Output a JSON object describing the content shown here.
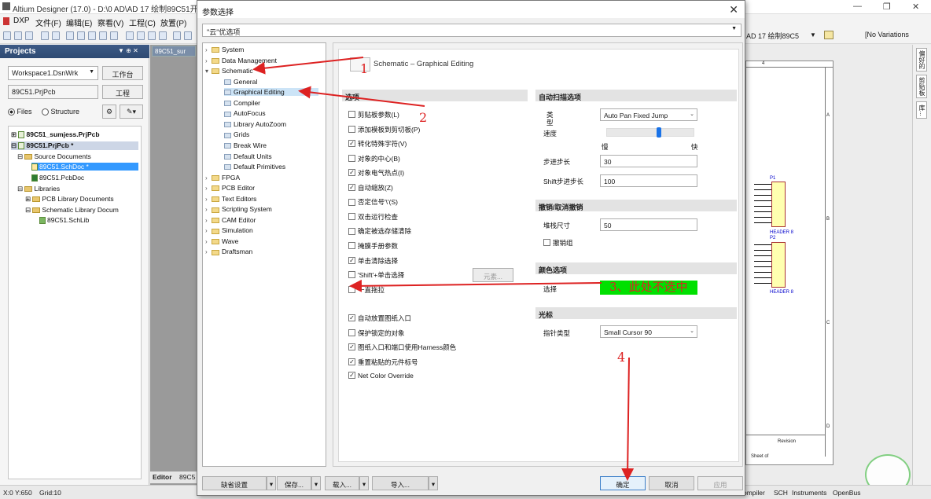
{
  "app": {
    "title": "Altium Designer (17.0) - D:\\0 AD\\AD 17 绘制89C51开",
    "menu": [
      "DXP",
      "文件(F)",
      "编辑(E)",
      "察看(V)",
      "工程(C)",
      "放置(P)"
    ],
    "toolbar_right": {
      "doc_combo": "AD 17 绘制89C5",
      "variations": "[No Variations"
    },
    "window_controls": [
      "—",
      "❐",
      "✕"
    ]
  },
  "projects": {
    "title": "Projects",
    "workspace": "Workspace1.DsnWrk",
    "workspace_btn": "工作台",
    "project_field": "89C51.PrjPcb",
    "project_btn": "工程",
    "radio_files": "Files",
    "radio_structure": "Structure",
    "tree": [
      "89C51_sumjess.PrjPcb",
      "89C51.PrjPcb *",
      "Source Documents",
      "89C51.SchDoc *",
      "89C51.PcbDoc",
      "Libraries",
      "PCB Library Documents",
      "Schematic Library Docum",
      "89C51.SchLib"
    ]
  },
  "editor": {
    "tab": "89C51_sur",
    "bottom_tab": "Editor",
    "bottom_tab2": "89C5"
  },
  "statusbar": {
    "coords": "X:0 Y:650",
    "grid": "Grid:10",
    "right_tabs": [
      "ompiler",
      "SCH",
      "Instruments",
      "OpenBus"
    ]
  },
  "rightbar": [
    "偏好的",
    "剪贴板",
    "库..."
  ],
  "schematic": {
    "col_label": "4",
    "rows": [
      "A",
      "B",
      "C",
      "D"
    ],
    "part1": "P1",
    "part2": "P2",
    "hdr": "HEADER 8",
    "revision": "Revision",
    "sheet": "Sheet of"
  },
  "dialog": {
    "title": "参数选择",
    "combo": "\"云\"优选项",
    "tree": [
      {
        "label": "System",
        "type": "folder",
        "level": 0
      },
      {
        "label": "Data Management",
        "type": "folder",
        "level": 0
      },
      {
        "label": "Schematic",
        "type": "folder",
        "level": 0,
        "expanded": true
      },
      {
        "label": "General",
        "type": "page",
        "level": 1
      },
      {
        "label": "Graphical Editing",
        "type": "page",
        "level": 1,
        "selected": true
      },
      {
        "label": "Compiler",
        "type": "page",
        "level": 1
      },
      {
        "label": "AutoFocus",
        "type": "page",
        "level": 1
      },
      {
        "label": "Library AutoZoom",
        "type": "page",
        "level": 1
      },
      {
        "label": "Grids",
        "type": "page",
        "level": 1
      },
      {
        "label": "Break Wire",
        "type": "page",
        "level": 1
      },
      {
        "label": "Default Units",
        "type": "page",
        "level": 1
      },
      {
        "label": "Default Primitives",
        "type": "page",
        "level": 1
      },
      {
        "label": "FPGA",
        "type": "folder",
        "level": 0
      },
      {
        "label": "PCB Editor",
        "type": "folder",
        "level": 0
      },
      {
        "label": "Text Editors",
        "type": "folder",
        "level": 0
      },
      {
        "label": "Scripting System",
        "type": "folder",
        "level": 0
      },
      {
        "label": "CAM Editor",
        "type": "folder",
        "level": 0
      },
      {
        "label": "Simulation",
        "type": "folder",
        "level": 0
      },
      {
        "label": "Wave",
        "type": "folder",
        "level": 0
      },
      {
        "label": "Draftsman",
        "type": "folder",
        "level": 0
      }
    ],
    "page_title": "Schematic – Graphical Editing",
    "options_header": "选项",
    "options": [
      {
        "label": "剪贴板参数(L)",
        "checked": false
      },
      {
        "label": "添加模板到剪切板(P)",
        "checked": false
      },
      {
        "label": "转化特殊字符(V)",
        "checked": true
      },
      {
        "label": "对象的中心(B)",
        "checked": false
      },
      {
        "label": "对象电气热点(I)",
        "checked": true
      },
      {
        "label": "自动缩放(Z)",
        "checked": true
      },
      {
        "label": "否定信号'\\'(S)",
        "checked": false
      },
      {
        "label": "双击运行检查",
        "checked": false
      },
      {
        "label": "确定被选存储清除",
        "checked": false
      },
      {
        "label": "掩膜手册参数",
        "checked": false
      },
      {
        "label": "单击清除选择",
        "checked": true
      },
      {
        "label": "'Shift'+单击选择",
        "checked": false
      },
      {
        "label": "一直拖拉",
        "checked": false
      },
      {
        "label": "自动放置图纸入口",
        "checked": true
      },
      {
        "label": "保护锁定的对象",
        "checked": false
      },
      {
        "label": "图纸入口和端口使用Harness颜色",
        "checked": true
      },
      {
        "label": "重置粘贴的元件标号",
        "checked": true
      },
      {
        "label": "Net Color Override",
        "checked": true
      }
    ],
    "elements_btn": "元素...",
    "autopan": {
      "header": "自动扫描选项",
      "type_label": "类型",
      "type_value": "Auto Pan Fixed Jump",
      "speed_label": "速度",
      "slow": "慢",
      "fast": "快",
      "speed_level": 0.6,
      "step_label": "步进步长",
      "step_value": "30",
      "shift_step_label": "Shift步进步长",
      "shift_step_value": "100"
    },
    "undo": {
      "header": "撤销/取消撤销",
      "stack_label": "堆栈尺寸",
      "stack_value": "50",
      "group_label": "撤销组"
    },
    "color": {
      "header": "颜色选项",
      "select_label": "选择",
      "select_color": "#00e000"
    },
    "cursor": {
      "header": "光标",
      "type_label": "指针类型",
      "type_value": "Small Cursor 90"
    },
    "buttons": {
      "defaults": "缺省设置",
      "save": "保存...",
      "load": "载入...",
      "import": "导入...",
      "ok": "确定",
      "cancel": "取消",
      "apply": "应用"
    }
  },
  "annotations": {
    "a1": "1",
    "a2": "2",
    "a3": "3、此处不选中",
    "a4": "4"
  }
}
